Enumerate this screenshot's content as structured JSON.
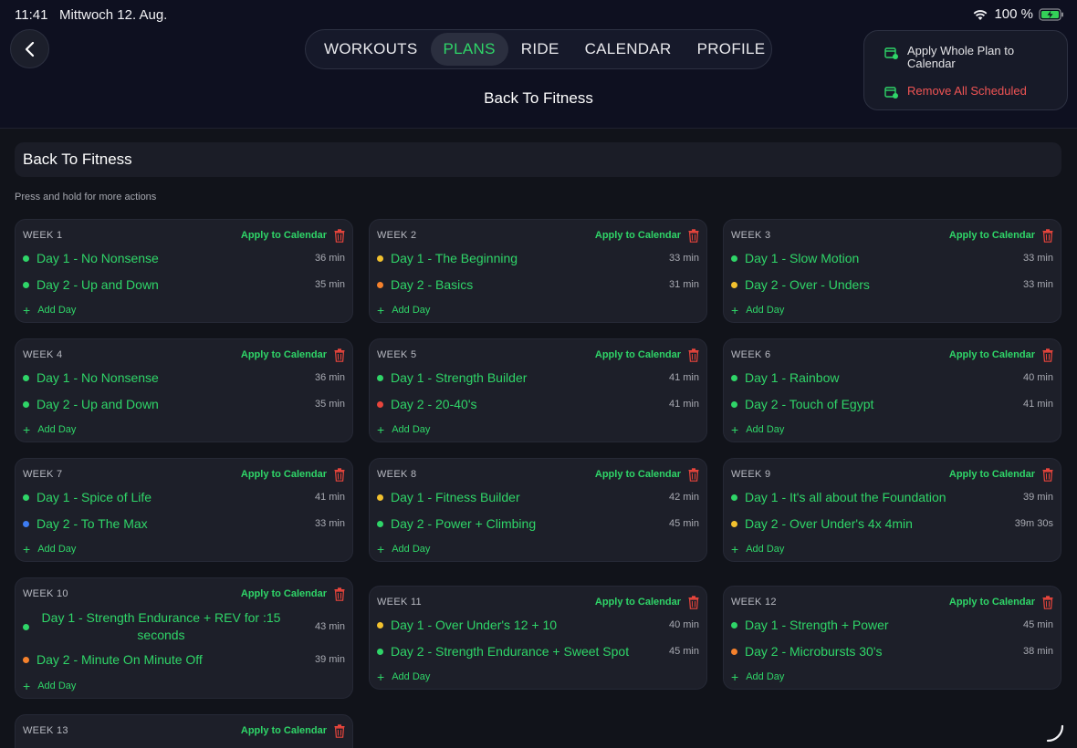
{
  "status_bar": {
    "time": "11:41",
    "date": "Mittwoch 12. Aug.",
    "battery": "100 %"
  },
  "nav": {
    "tabs": [
      {
        "label": "WORKOUTS",
        "active": false
      },
      {
        "label": "PLANS",
        "active": true
      },
      {
        "label": "RIDE",
        "active": false
      },
      {
        "label": "CALENDAR",
        "active": false
      },
      {
        "label": "PROFILE",
        "active": false
      }
    ]
  },
  "header": {
    "title": "Back To Fitness"
  },
  "menu": {
    "apply_whole": "Apply Whole Plan to Calendar",
    "remove_all": "Remove All Scheduled"
  },
  "plan": {
    "name": "Back To Fitness",
    "hint": "Press and hold for more actions"
  },
  "labels": {
    "apply_to_calendar": "Apply to Calendar",
    "add_day": "Add Day"
  },
  "colors": {
    "accent": "#2fd568",
    "danger": "#f05454",
    "yellow": "#f2c12e",
    "orange": "#f5812c",
    "red": "#e8453c",
    "blue": "#3d7cf2"
  },
  "weeks": [
    {
      "label": "WEEK 1",
      "days": [
        {
          "name": "Day 1 - No Nonsense",
          "duration": "36 min",
          "dot": "#2fd568"
        },
        {
          "name": "Day 2 - Up and Down",
          "duration": "35 min",
          "dot": "#2fd568"
        }
      ]
    },
    {
      "label": "WEEK 2",
      "days": [
        {
          "name": "Day 1 - The Beginning",
          "duration": "33 min",
          "dot": "#f2c12e"
        },
        {
          "name": "Day 2 - Basics",
          "duration": "31 min",
          "dot": "#f5812c"
        }
      ]
    },
    {
      "label": "WEEK 3",
      "days": [
        {
          "name": "Day 1 - Slow Motion",
          "duration": "33 min",
          "dot": "#2fd568"
        },
        {
          "name": "Day 2 - Over - Unders",
          "duration": "33 min",
          "dot": "#f2c12e"
        }
      ]
    },
    {
      "label": "WEEK 4",
      "days": [
        {
          "name": "Day 1 - No Nonsense",
          "duration": "36 min",
          "dot": "#2fd568"
        },
        {
          "name": "Day 2 - Up and Down",
          "duration": "35 min",
          "dot": "#2fd568"
        }
      ]
    },
    {
      "label": "WEEK 5",
      "days": [
        {
          "name": "Day 1 - Strength Builder",
          "duration": "41 min",
          "dot": "#2fd568"
        },
        {
          "name": "Day 2 - 20-40's",
          "duration": "41 min",
          "dot": "#e8453c"
        }
      ]
    },
    {
      "label": "WEEK 6",
      "days": [
        {
          "name": "Day 1 - Rainbow",
          "duration": "40 min",
          "dot": "#2fd568"
        },
        {
          "name": "Day 2 - Touch of Egypt",
          "duration": "41 min",
          "dot": "#2fd568"
        }
      ]
    },
    {
      "label": "WEEK 7",
      "days": [
        {
          "name": "Day 1 - Spice of Life",
          "duration": "41 min",
          "dot": "#2fd568"
        },
        {
          "name": "Day 2 - To The Max",
          "duration": "33 min",
          "dot": "#3d7cf2"
        }
      ]
    },
    {
      "label": "WEEK 8",
      "days": [
        {
          "name": "Day 1 - Fitness Builder",
          "duration": "42 min",
          "dot": "#f2c12e"
        },
        {
          "name": "Day 2 - Power + Climbing",
          "duration": "45 min",
          "dot": "#2fd568"
        }
      ]
    },
    {
      "label": "WEEK 9",
      "days": [
        {
          "name": "Day 1 - It's all about the Foundation",
          "duration": "39 min",
          "dot": "#2fd568"
        },
        {
          "name": "Day 2 - Over Under's 4x 4min",
          "duration": "39m 30s",
          "dot": "#f2c12e"
        }
      ]
    },
    {
      "label": "WEEK 10",
      "days": [
        {
          "name": "Day 1 - Strength Endurance + REV for :15 seconds",
          "duration": "43 min",
          "dot": "#2fd568"
        },
        {
          "name": "Day 2 - Minute On Minute Off",
          "duration": "39 min",
          "dot": "#f5812c"
        }
      ]
    },
    {
      "label": "WEEK 11",
      "days": [
        {
          "name": "Day 1 - Over Under's 12 + 10",
          "duration": "40 min",
          "dot": "#f2c12e"
        },
        {
          "name": "Day 2 - Strength Endurance + Sweet Spot",
          "duration": "45 min",
          "dot": "#2fd568"
        }
      ]
    },
    {
      "label": "WEEK 12",
      "days": [
        {
          "name": "Day 1 - Strength + Power",
          "duration": "45 min",
          "dot": "#2fd568"
        },
        {
          "name": "Day 2 - Microbursts 30's",
          "duration": "38 min",
          "dot": "#f5812c"
        }
      ]
    },
    {
      "label": "WEEK 13",
      "days": []
    }
  ]
}
